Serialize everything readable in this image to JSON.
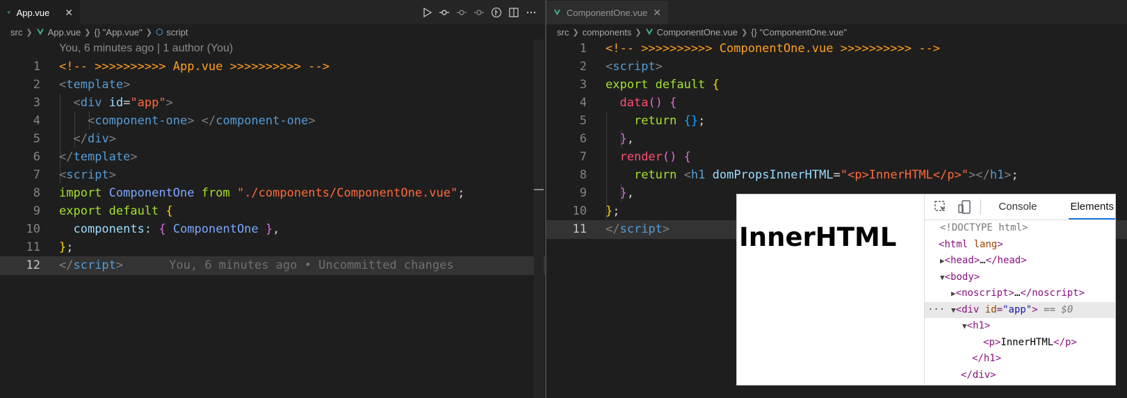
{
  "left": {
    "tab": {
      "label": "App.vue",
      "close": "✕"
    },
    "breadcrumb": [
      "src",
      "App.vue",
      "{} \"App.vue\"",
      "script"
    ],
    "blame_header": "You, 6 minutes ago | 1 author (You)",
    "inline_blame": "You, 6 minutes ago • Uncommitted changes",
    "line_numbers": [
      "1",
      "2",
      "3",
      "4",
      "5",
      "6",
      "7",
      "8",
      "9",
      "10",
      "11",
      "12"
    ]
  },
  "right": {
    "tab": {
      "label": "ComponentOne.vue",
      "close": "✕"
    },
    "breadcrumb": [
      "src",
      "components",
      "ComponentOne.vue",
      "{} \"ComponentOne.vue\""
    ],
    "line_numbers": [
      "1",
      "2",
      "3",
      "4",
      "5",
      "6",
      "7",
      "8",
      "9",
      "10",
      "11"
    ]
  },
  "code_left": {
    "l1": "<!-- >>>>>>>>>> App.vue >>>>>>>>>> -->",
    "l2_tag": "template",
    "l3_tag": "div",
    "l3_attr": "id",
    "l3_val": "\"app\"",
    "l4_tag": "component-one",
    "l5_tag": "div",
    "l6_tag": "template",
    "l7_tag": "script",
    "l8_import": "import",
    "l8_name": "ComponentOne",
    "l8_from": "from",
    "l8_path": "\"./components/ComponentOne.vue\"",
    "l9_export": "export default",
    "l10_key": "components:",
    "l10_name": "ComponentOne",
    "l12_tag": "script"
  },
  "code_right": {
    "l1": "<!-- >>>>>>>>>> ComponentOne.vue >>>>>>>>>> -->",
    "l2_tag": "script",
    "l3_export": "export default",
    "l4_fn": "data",
    "l5_return": "return",
    "l7_fn": "render",
    "l8_return": "return",
    "l8_tag": "h1",
    "l8_attr": "domPropsInnerHTML",
    "l8_val": "\"<p>InnerHTML</p>\"",
    "l11_tag": "script"
  },
  "browser": {
    "rendered_heading": "InnerHTML",
    "tabs": [
      "Console",
      "Elements"
    ],
    "dom": {
      "doctype": "<!DOCTYPE html>",
      "html": "html",
      "lang": "lang",
      "head": "head",
      "ellipsis": "…",
      "body": "body",
      "noscript": "noscript",
      "div": "div",
      "div_attr": "id",
      "div_val": "\"app\"",
      "div_sel": "== $0",
      "h1": "h1",
      "p": "p",
      "p_text": "InnerHTML",
      "dots": "···"
    }
  },
  "colors": {
    "vue_green": "#41b883",
    "editor_bg": "#1e1e1e",
    "tab_bg": "#252526"
  }
}
